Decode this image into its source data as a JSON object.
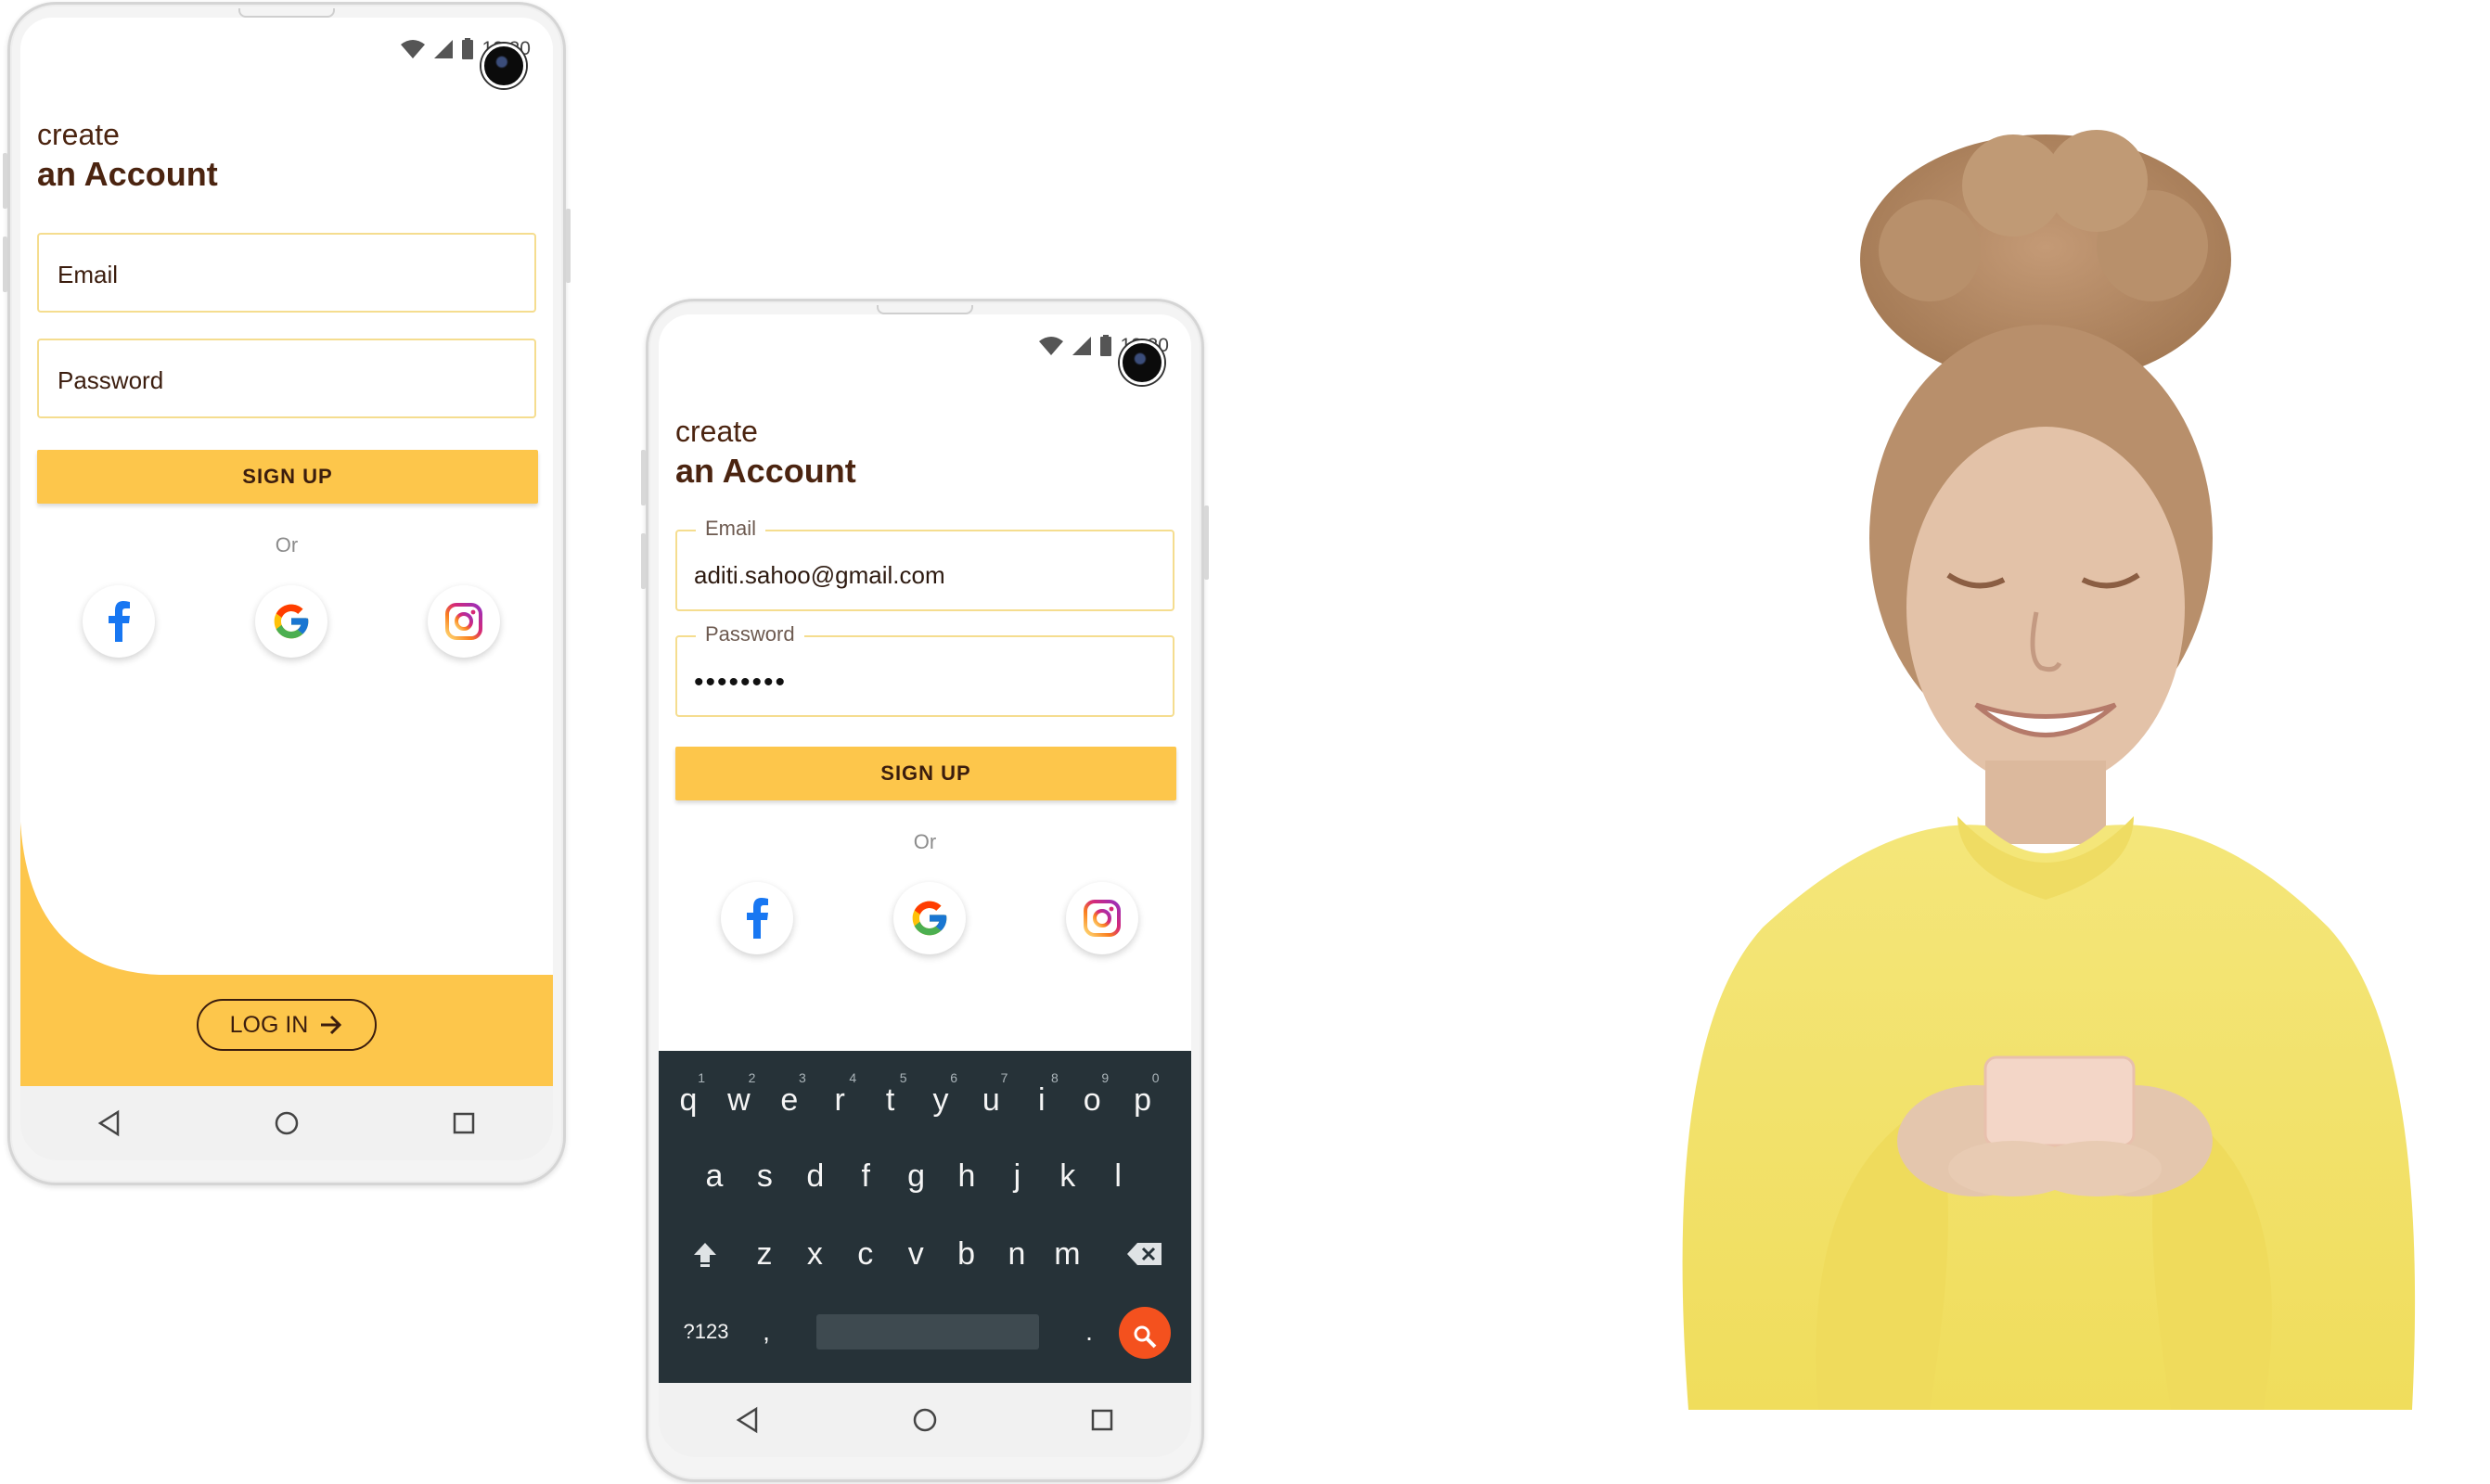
{
  "status": {
    "time": "12:30"
  },
  "phone1": {
    "title_small": "create",
    "title_big": "an Account",
    "email_placeholder": "Email",
    "password_placeholder": "Password",
    "signup_label": "SIGN UP",
    "or_label": "Or",
    "login_label": "LOG IN",
    "arrow_icon": "arrow-right-icon"
  },
  "phone2": {
    "title_small": "create",
    "title_big": "an Account",
    "email_label": "Email",
    "email_value": "aditi.sahoo@gmail.com",
    "password_label": "Password",
    "password_value": "••••••••",
    "signup_label": "SIGN UP",
    "or_label": "Or"
  },
  "keyboard": {
    "row1": [
      {
        "key": "q",
        "hint": "1"
      },
      {
        "key": "w",
        "hint": "2"
      },
      {
        "key": "e",
        "hint": "3"
      },
      {
        "key": "r",
        "hint": "4"
      },
      {
        "key": "t",
        "hint": "5"
      },
      {
        "key": "y",
        "hint": "6"
      },
      {
        "key": "u",
        "hint": "7"
      },
      {
        "key": "i",
        "hint": "8"
      },
      {
        "key": "o",
        "hint": "9"
      },
      {
        "key": "p",
        "hint": "0"
      }
    ],
    "row2": [
      "a",
      "s",
      "d",
      "f",
      "g",
      "h",
      "j",
      "k",
      "l"
    ],
    "row3": [
      "z",
      "x",
      "c",
      "v",
      "b",
      "n",
      "m"
    ],
    "symbols_key": "?123",
    "comma_key": ",",
    "period_key": "."
  },
  "colors": {
    "accent": "#fdc64b",
    "text_brown": "#3b1d0e",
    "keyboard_bg": "#263238",
    "search_key": "#f4511e"
  },
  "icons": [
    "wifi-icon",
    "signal-icon",
    "battery-icon",
    "facebook-icon",
    "google-icon",
    "instagram-icon",
    "back-icon",
    "home-icon",
    "recents-icon",
    "shift-icon",
    "backspace-icon",
    "search-icon"
  ]
}
